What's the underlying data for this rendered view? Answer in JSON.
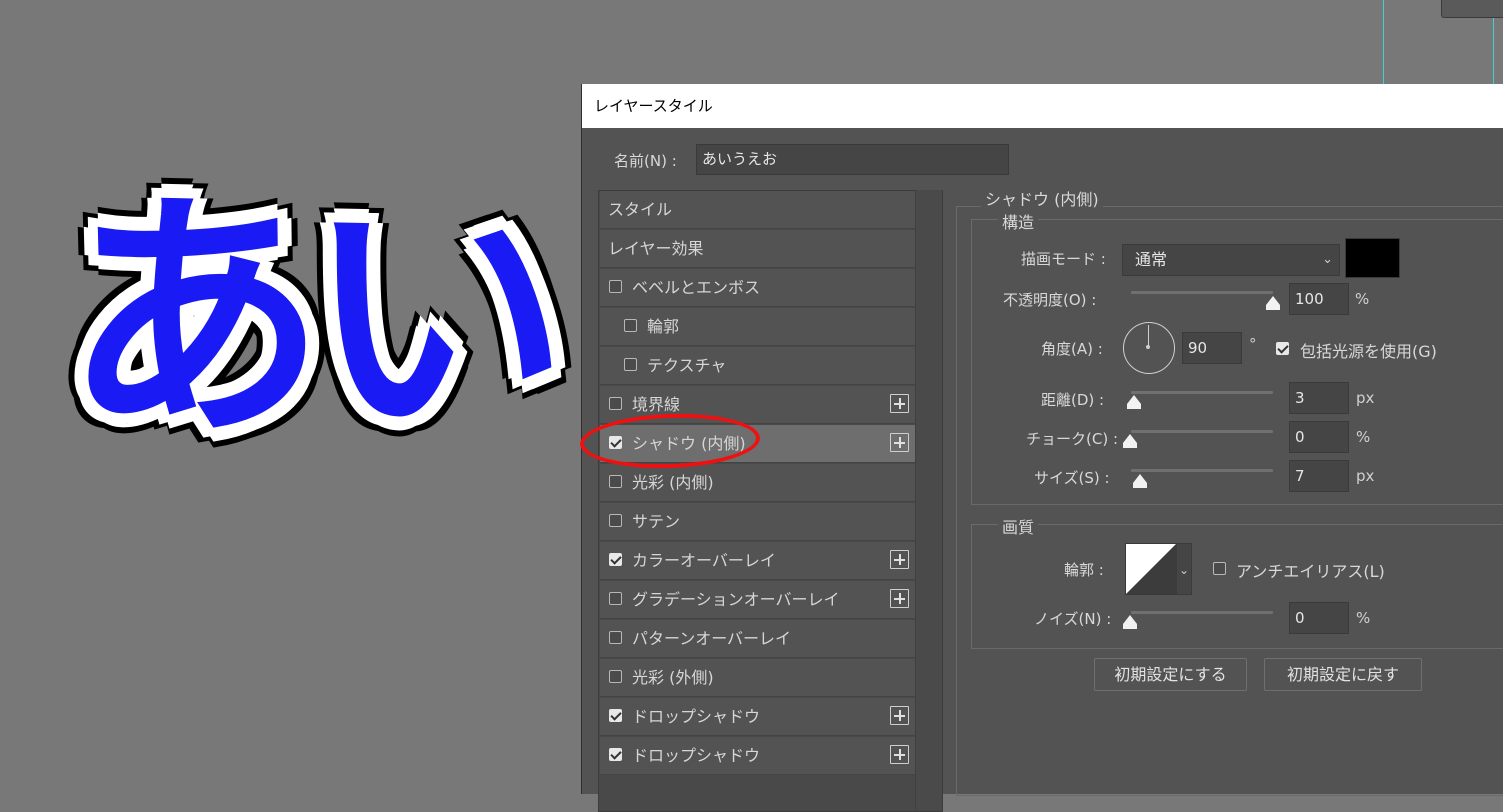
{
  "canvas": {
    "text": "あい",
    "text_color": "#1a1af5"
  },
  "dialog": {
    "title": "レイヤースタイル",
    "name_label": "名前(N) :",
    "name_value": "あいうえお"
  },
  "styles_list": {
    "items": [
      {
        "label": "スタイル",
        "checkbox": false,
        "checked": false,
        "plus": false,
        "indent": 0
      },
      {
        "label": "レイヤー効果",
        "checkbox": false,
        "checked": false,
        "plus": false,
        "indent": 0
      },
      {
        "label": "ベベルとエンボス",
        "checkbox": true,
        "checked": false,
        "plus": false,
        "indent": 0
      },
      {
        "label": "輪郭",
        "checkbox": true,
        "checked": false,
        "plus": false,
        "indent": 1
      },
      {
        "label": "テクスチャ",
        "checkbox": true,
        "checked": false,
        "plus": false,
        "indent": 1
      },
      {
        "label": "境界線",
        "checkbox": true,
        "checked": false,
        "plus": true,
        "indent": 0
      },
      {
        "label": "シャドウ (内側)",
        "checkbox": true,
        "checked": true,
        "plus": true,
        "indent": 0,
        "active": true
      },
      {
        "label": "光彩 (内側)",
        "checkbox": true,
        "checked": false,
        "plus": false,
        "indent": 0
      },
      {
        "label": "サテン",
        "checkbox": true,
        "checked": false,
        "plus": false,
        "indent": 0
      },
      {
        "label": "カラーオーバーレイ",
        "checkbox": true,
        "checked": true,
        "plus": true,
        "indent": 0
      },
      {
        "label": "グラデーションオーバーレイ",
        "checkbox": true,
        "checked": false,
        "plus": true,
        "indent": 0
      },
      {
        "label": "パターンオーバーレイ",
        "checkbox": true,
        "checked": false,
        "plus": false,
        "indent": 0
      },
      {
        "label": "光彩 (外側)",
        "checkbox": true,
        "checked": false,
        "plus": false,
        "indent": 0
      },
      {
        "label": "ドロップシャドウ",
        "checkbox": true,
        "checked": true,
        "plus": true,
        "indent": 0
      },
      {
        "label": "ドロップシャドウ",
        "checkbox": true,
        "checked": true,
        "plus": true,
        "indent": 0
      }
    ]
  },
  "panel": {
    "section_title": "シャドウ (内側)",
    "structure": {
      "title": "構造",
      "blend_mode_label": "描画モード :",
      "blend_mode_value": "通常",
      "shadow_color": "#000000",
      "opacity_label": "不透明度(O) :",
      "opacity_value": "100",
      "opacity_unit": "%",
      "angle_label": "角度(A) :",
      "angle_value": "90",
      "angle_unit": "°",
      "global_light_label": "包括光源を使用(G)",
      "global_light_checked": true,
      "distance_label": "距離(D) :",
      "distance_value": "3",
      "distance_unit": "px",
      "choke_label": "チョーク(C) :",
      "choke_value": "0",
      "choke_unit": "%",
      "size_label": "サイズ(S) :",
      "size_value": "7",
      "size_unit": "px"
    },
    "quality": {
      "title": "画質",
      "contour_label": "輪郭 :",
      "antialias_label": "アンチエイリアス(L)",
      "antialias_checked": false,
      "noise_label": "ノイズ(N) :",
      "noise_value": "0",
      "noise_unit": "%"
    },
    "buttons": {
      "make_default": "初期設定にする",
      "reset_default": "初期設定に戻す"
    }
  }
}
